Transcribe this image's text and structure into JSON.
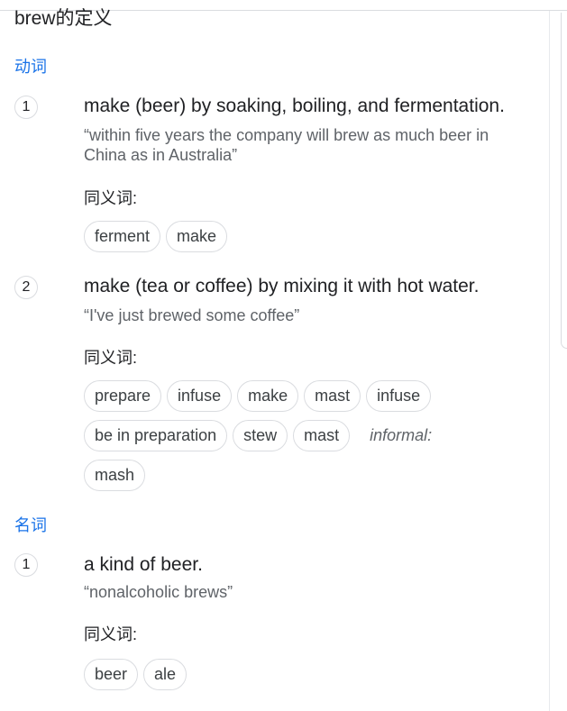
{
  "title": "brew的定义",
  "senses": {
    "verb": {
      "pos": "动词",
      "defs": [
        {
          "num": "1",
          "definition": "make (beer) by soaking, boiling, and fermentation.",
          "example": "“within five years the company will brew as much beer in China as in Australia”",
          "syn_label": "同义词:",
          "synonyms": [
            "ferment",
            "make"
          ]
        },
        {
          "num": "2",
          "definition": "make (tea or coffee) by mixing it with hot water.",
          "example": "“I've just brewed some coffee”",
          "syn_label": "同义词:",
          "synonyms": [
            "prepare",
            "infuse",
            "make",
            "mast",
            "infuse",
            "be in preparation",
            "stew",
            "mast",
            "mash"
          ],
          "register": "informal:"
        }
      ]
    },
    "noun": {
      "pos": "名词",
      "defs": [
        {
          "num": "1",
          "definition": "a kind of beer.",
          "example": "“nonalcoholic brews”",
          "syn_label": "同义词:",
          "synonyms": [
            "beer",
            "ale"
          ]
        }
      ]
    }
  }
}
